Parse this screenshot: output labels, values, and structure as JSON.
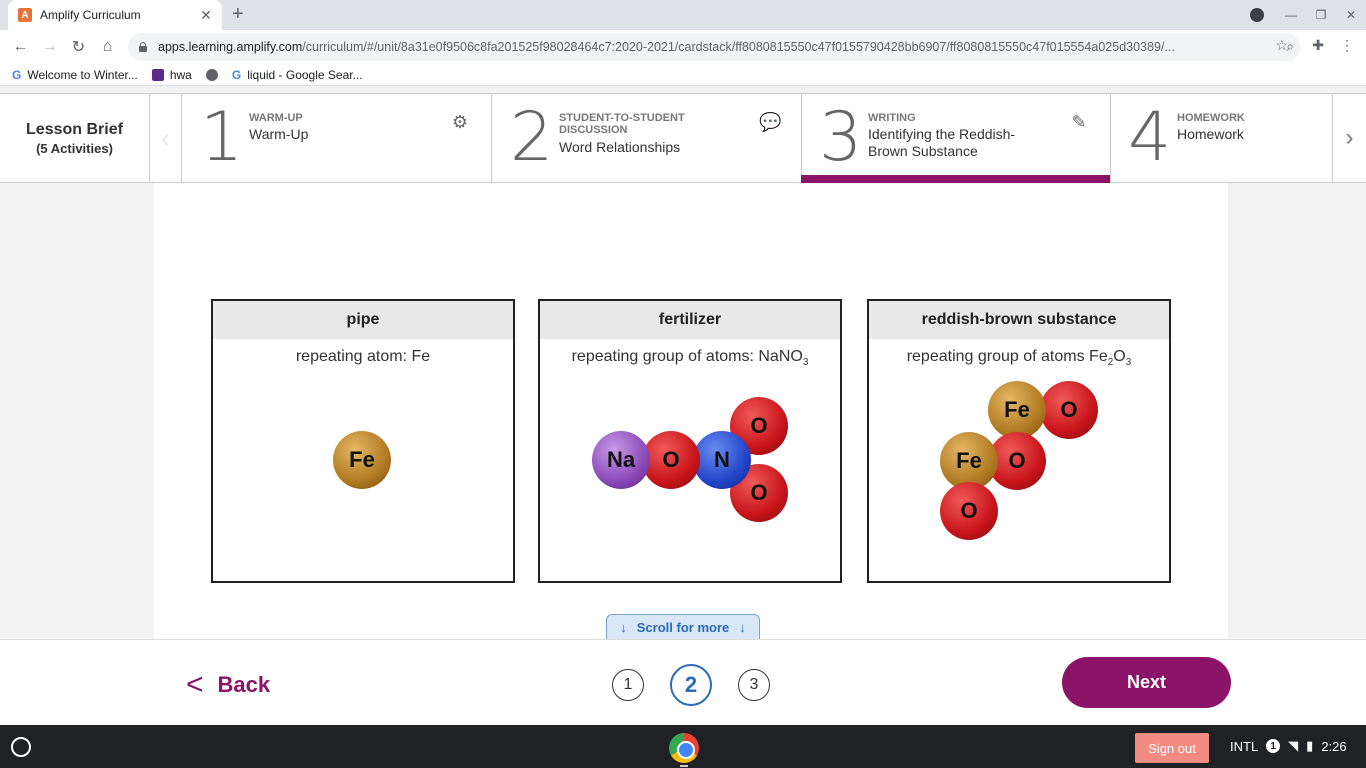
{
  "browser": {
    "tab_title": "Amplify Curriculum",
    "tab_favicon": "A",
    "url_host": "apps.learning.amplify.com",
    "url_path": "/curriculum/#/unit/8a31e0f9506c8fa201525f98028464c7:2020-2021/cardstack/ff8080815550c47f0155790428bb6907/ff8080815550c47f015554a025d30389/...",
    "bookmarks": [
      {
        "label": "Welcome to Winter..."
      },
      {
        "label": "hwa"
      },
      {
        "label": ""
      },
      {
        "label": "liquid - Google Sear..."
      }
    ]
  },
  "lesson_nav": {
    "brief_title": "Lesson Brief",
    "brief_sub": "(5 Activities)",
    "activities": [
      {
        "num": "1",
        "category": "WARM-UP",
        "title": "Warm-Up",
        "icon": "gear-head-icon"
      },
      {
        "num": "2",
        "category": "STUDENT-TO-STUDENT DISCUSSION",
        "title": "Word Relationships",
        "icon": "chat-bubbles-icon"
      },
      {
        "num": "3",
        "category": "WRITING",
        "title": "Identifying the Reddish-Brown Substance",
        "icon": "pencil-icon"
      },
      {
        "num": "4",
        "category": "HOMEWORK",
        "title": "Homework",
        "icon": ""
      }
    ],
    "accent_color": "#8b1368"
  },
  "cards": [
    {
      "title": "pipe",
      "subtitle": "repeating atom: Fe",
      "atoms": [
        "Fe"
      ]
    },
    {
      "title": "fertilizer",
      "subtitle_main": "repeating group of atoms: NaNO",
      "subtitle_sub": "3",
      "atoms": [
        "Na",
        "O",
        "N",
        "O",
        "O"
      ]
    },
    {
      "title": "reddish-brown substance",
      "subtitle_a": "repeating group of atoms Fe",
      "subtitle_sub1": "2",
      "subtitle_b": "O",
      "subtitle_sub2": "3",
      "atoms": [
        "Fe",
        "O",
        "Fe",
        "O",
        "O"
      ]
    }
  ],
  "scroll_hint": "Scroll for more",
  "footer": {
    "back_label": "Back",
    "pages": [
      "1",
      "2",
      "3"
    ],
    "current_page": "2",
    "next_label": "Next"
  },
  "taskbar": {
    "signout_label": "Sign out",
    "keyboard": "INTL",
    "notif_count": "1",
    "time": "2:26"
  }
}
